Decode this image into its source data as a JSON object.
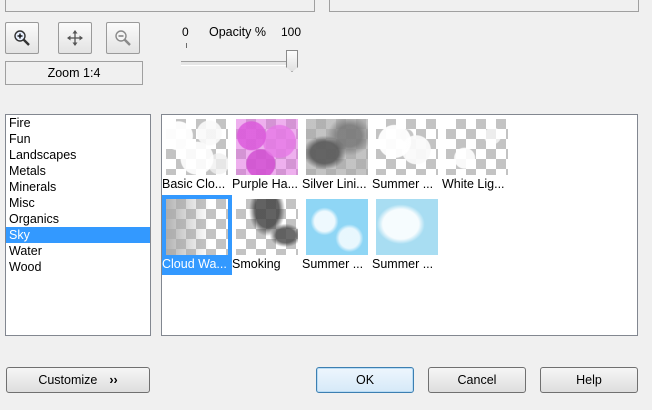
{
  "toolbar": {
    "zoom_in_icon": "magnifier-plus-icon",
    "pan_icon": "move-arrows-icon",
    "zoom_out_icon": "magnifier-minus-icon"
  },
  "zoom": {
    "label": "Zoom 1:4"
  },
  "opacity": {
    "min_label": "0",
    "label": "Opacity %",
    "max_label": "100",
    "value": 100
  },
  "categories": {
    "items": [
      "Fire",
      "Fun",
      "Landscapes",
      "Metals",
      "Minerals",
      "Misc",
      "Organics",
      "Sky",
      "Water",
      "Wood"
    ],
    "selected": "Sky"
  },
  "thumbnails": [
    {
      "caption": "Basic Clo...",
      "style": "basic"
    },
    {
      "caption": "Purple Ha...",
      "style": "purple"
    },
    {
      "caption": "Silver Lini...",
      "style": "silver"
    },
    {
      "caption": "Summer ...",
      "style": "summer1"
    },
    {
      "caption": "White Lig...",
      "style": "white"
    },
    {
      "caption": "Cloud Wa...",
      "style": "cloudwall",
      "selected": true
    },
    {
      "caption": "Smoking",
      "style": "smoking"
    },
    {
      "caption": "Summer ...",
      "style": "sky1"
    },
    {
      "caption": "Summer ...",
      "style": "sky2"
    }
  ],
  "buttons": {
    "customize": "Customize",
    "customize_glyph": "››",
    "ok": "OK",
    "cancel": "Cancel",
    "help": "Help"
  },
  "colors": {
    "selection": "#3399ff"
  }
}
